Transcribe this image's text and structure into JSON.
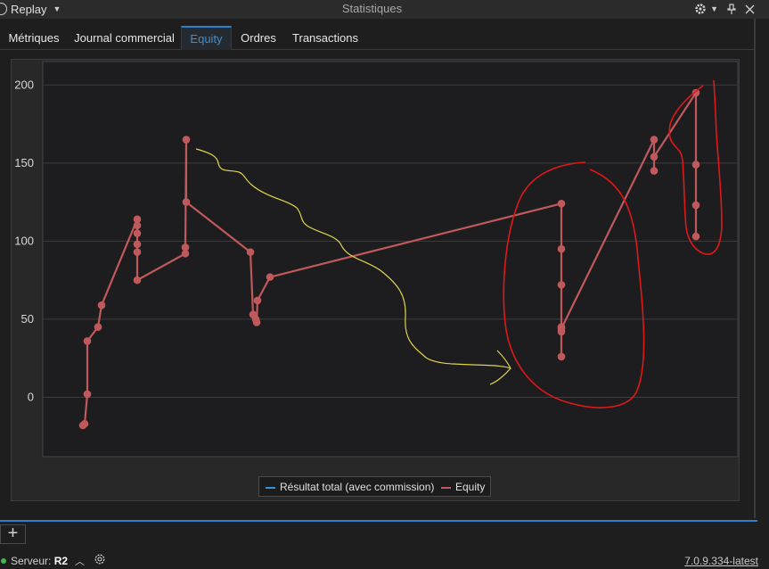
{
  "titlebar": {
    "app_name": "Replay",
    "title": "Statistiques"
  },
  "tabs": [
    {
      "label": "Métriques",
      "active": false
    },
    {
      "label": "Journal commercial",
      "active": false
    },
    {
      "label": "Equity",
      "active": true
    },
    {
      "label": "Ordres",
      "active": false
    },
    {
      "label": "Transactions",
      "active": false
    }
  ],
  "status": {
    "server_label": "Serveur:",
    "server_name": "R2",
    "version": "7.0.9.334-latest"
  },
  "add_button": "+",
  "colors": {
    "equity": "#c0595b",
    "total_result": "#3b8fd6",
    "annotation_yellow": "#e0d44a",
    "annotation_red": "#e01818",
    "accent": "#2d7fd0"
  },
  "chart_data": {
    "type": "line",
    "ylim": [
      -38,
      215
    ],
    "yticks": [
      0,
      50,
      100,
      150,
      200
    ],
    "grid": true,
    "legend_position": "bottom-center",
    "legend": [
      "Résultat total (avec commission)",
      "Equity"
    ],
    "series": [
      {
        "name": "Résultat total (avec commission)",
        "values": []
      },
      {
        "name": "Equity",
        "values": [
          -18,
          -17,
          2,
          36,
          45,
          59,
          114,
          110,
          105,
          98,
          93,
          75,
          92,
          96,
          165,
          125,
          93,
          53,
          50,
          48,
          62,
          77,
          124,
          95,
          72,
          45,
          42,
          26,
          44,
          165,
          145,
          154,
          195,
          149,
          123,
          103
        ]
      }
    ]
  }
}
